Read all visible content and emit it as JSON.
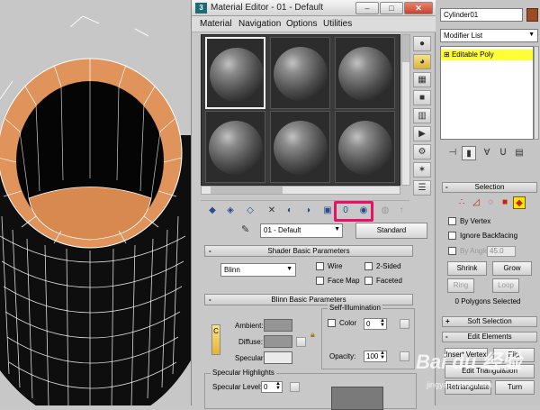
{
  "material_editor": {
    "title": "Material Editor - 01 - Default",
    "window_buttons": {
      "minimize": "–",
      "maximize": "□",
      "close": "✕"
    },
    "menu": [
      "Material",
      "Navigation",
      "Options",
      "Utilities"
    ],
    "slots_count": 6,
    "active_slot": 0,
    "material_name": "01 - Default",
    "material_type": "Standard",
    "shader_rollout": {
      "title": "Shader Basic Parameters",
      "shader": "Blinn",
      "wire": "Wire",
      "two_sided": "2-Sided",
      "face_map": "Face Map",
      "faceted": "Faceted"
    },
    "blinn_rollout": {
      "title": "Blinn Basic Parameters",
      "self_illum": "Self-Illumination",
      "color_label": "Color",
      "color_value": "0",
      "ambient": "Ambient:",
      "diffuse": "Diffuse:",
      "specular": "Specular:",
      "opacity_label": "Opacity:",
      "opacity_value": "100",
      "lock_c": "C"
    },
    "spec_highlights": {
      "title": "Specular Highlights",
      "level_label": "Specular Level:",
      "level_value": "0"
    },
    "plus_minus": "-"
  },
  "command_panel": {
    "object_name": "Cylinder01",
    "object_color": "#9b4b21",
    "modifier_list": "Modifier List",
    "stack_item": "Editable Poly",
    "selection": {
      "title": "Selection",
      "by_vertex": "By Vertex",
      "ignore_backfacing": "Ignore Backfacing",
      "by_angle": "By Angle:",
      "angle_value": "45.0",
      "shrink": "Shrink",
      "grow": "Grow",
      "ring": "Ring",
      "loop": "Loop",
      "selected_count": "0 Polygons Selected"
    },
    "soft_selection": {
      "title": "Soft Selection",
      "pm": "+"
    },
    "edit_elements": {
      "title": "Edit Elements",
      "pm": "-",
      "insert_vertex": "Insert Vertex",
      "flip": "Flip",
      "edit_triangulation": "Edit Triangulation",
      "retriangulate": "Retriangulate",
      "turn": "Turn"
    }
  },
  "watermark": {
    "text": "Bai du 经验",
    "url": "jingyan.baidu.com"
  },
  "colors": {
    "highlight": "#e8116a",
    "cylinder_rim": "#e0935a",
    "stack_item_bg": "#ffff36"
  }
}
